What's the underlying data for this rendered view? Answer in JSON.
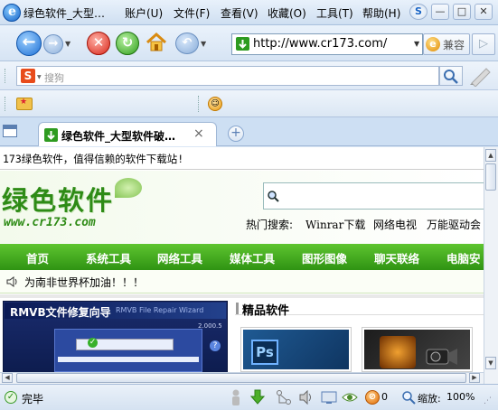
{
  "window": {
    "title": "绿色软件_大型…",
    "menu": [
      "账户(U)",
      "文件(F)",
      "查看(V)",
      "收藏(O)",
      "工具(T)",
      "帮助(H)"
    ],
    "controls": [
      "S",
      "—",
      "□",
      "✕"
    ]
  },
  "toolbar": {
    "address": "http://www.cr173.com/",
    "compat_label": "兼容"
  },
  "search": {
    "placeholder": "搜狗"
  },
  "tabs": [
    {
      "label": "绿色软件_大型软件破…",
      "close": "×"
    }
  ],
  "page": {
    "top_notice": "173绿色软件，值得信赖的软件下载站!",
    "logo_text": "绿色软件",
    "logo_url": "www.cr173.com",
    "hot_search_label": "热门搜索:",
    "hot_search_items": [
      "Winrar下载",
      "网络电视",
      "万能驱动会"
    ],
    "nav": [
      "首页",
      "系统工具",
      "网络工具",
      "媒体工具",
      "图形图像",
      "聊天联络",
      "电脑安"
    ],
    "announcement": "为南非世界杯加油！！！",
    "banner_title": "RMVB文件修复向导",
    "banner_subtitle": "RMVB File Repair Wizard",
    "banner_version": "2.000.5",
    "featured_heading": "精品软件"
  },
  "status": {
    "text": "完毕",
    "zoom_label": "缩放:",
    "zoom_value": "100%",
    "blocked_count": "0"
  },
  "colors": {
    "nav_green": "#3aa21a",
    "logo_green": "#2e8b16",
    "link_blue": "#1a4ea0"
  }
}
